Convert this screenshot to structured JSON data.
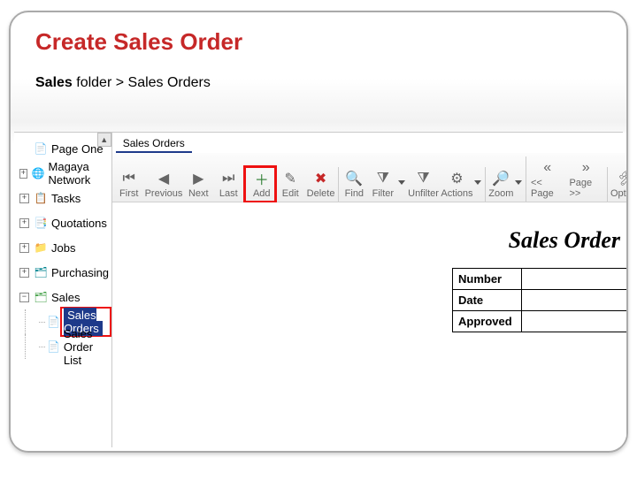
{
  "title": "Create Sales Order",
  "breadcrumb": {
    "bold": "Sales",
    "rest": " folder > Sales Orders"
  },
  "tree": {
    "scrollGlyph": "▲",
    "items": [
      {
        "exp": "",
        "icon": "📄",
        "iconClass": "ico-page",
        "label": "Page One"
      },
      {
        "exp": "+",
        "icon": "🌐",
        "iconClass": "ico-globe",
        "label": "Magaya Network"
      },
      {
        "exp": "+",
        "icon": "📋",
        "iconClass": "ico-task",
        "label": "Tasks"
      },
      {
        "exp": "+",
        "icon": "📑",
        "iconClass": "ico-quote",
        "label": "Quotations"
      },
      {
        "exp": "+",
        "icon": "📁",
        "iconClass": "ico-job",
        "label": "Jobs"
      },
      {
        "exp": "+",
        "icon": "🗂",
        "iconClass": "ico-purch",
        "label": "Purchasing"
      },
      {
        "exp": "−",
        "icon": "🗂",
        "iconClass": "ico-sales",
        "label": "Sales"
      }
    ],
    "children": [
      {
        "icon": "📄",
        "label": "Sales Orders",
        "selected": true,
        "highlight": true
      },
      {
        "icon": "📄",
        "label": "Sales Order List"
      }
    ]
  },
  "tab": "Sales Orders",
  "toolbar": [
    {
      "name": "first",
      "glyph": "⏮",
      "label": "First"
    },
    {
      "name": "previous",
      "glyph": "◀",
      "label": "Previous"
    },
    {
      "name": "next",
      "glyph": "▶",
      "label": "Next"
    },
    {
      "name": "last",
      "glyph": "⏭",
      "label": "Last"
    },
    {
      "name": "add",
      "glyph": "＋",
      "label": "Add",
      "sep": true,
      "highlight": true,
      "color": "#2e7d32"
    },
    {
      "name": "edit",
      "glyph": "✎",
      "label": "Edit"
    },
    {
      "name": "delete",
      "glyph": "✖",
      "label": "Delete",
      "color": "#c62828"
    },
    {
      "name": "find",
      "glyph": "🔍",
      "label": "Find",
      "sep": true
    },
    {
      "name": "filter",
      "glyph": "⧩",
      "label": "Filter",
      "dropdown": true
    },
    {
      "name": "unfilter",
      "glyph": "⧩",
      "label": "Unfilter"
    },
    {
      "name": "actions",
      "glyph": "⚙",
      "label": "Actions",
      "dropdown": true
    },
    {
      "name": "zoom",
      "glyph": "🔎",
      "label": "Zoom",
      "sep": true,
      "dropdown": true
    },
    {
      "name": "page-prev",
      "glyph": "«",
      "label": "<< Page",
      "sep": true
    },
    {
      "name": "page-next",
      "glyph": "»",
      "label": "Page >>"
    },
    {
      "name": "options",
      "glyph": "🛠",
      "label": "Options",
      "sep": true
    }
  ],
  "docTitle": "Sales Order",
  "fields": [
    {
      "label": "Number",
      "value": ""
    },
    {
      "label": "Date",
      "value": ""
    },
    {
      "label": "Approved",
      "value": ""
    }
  ]
}
